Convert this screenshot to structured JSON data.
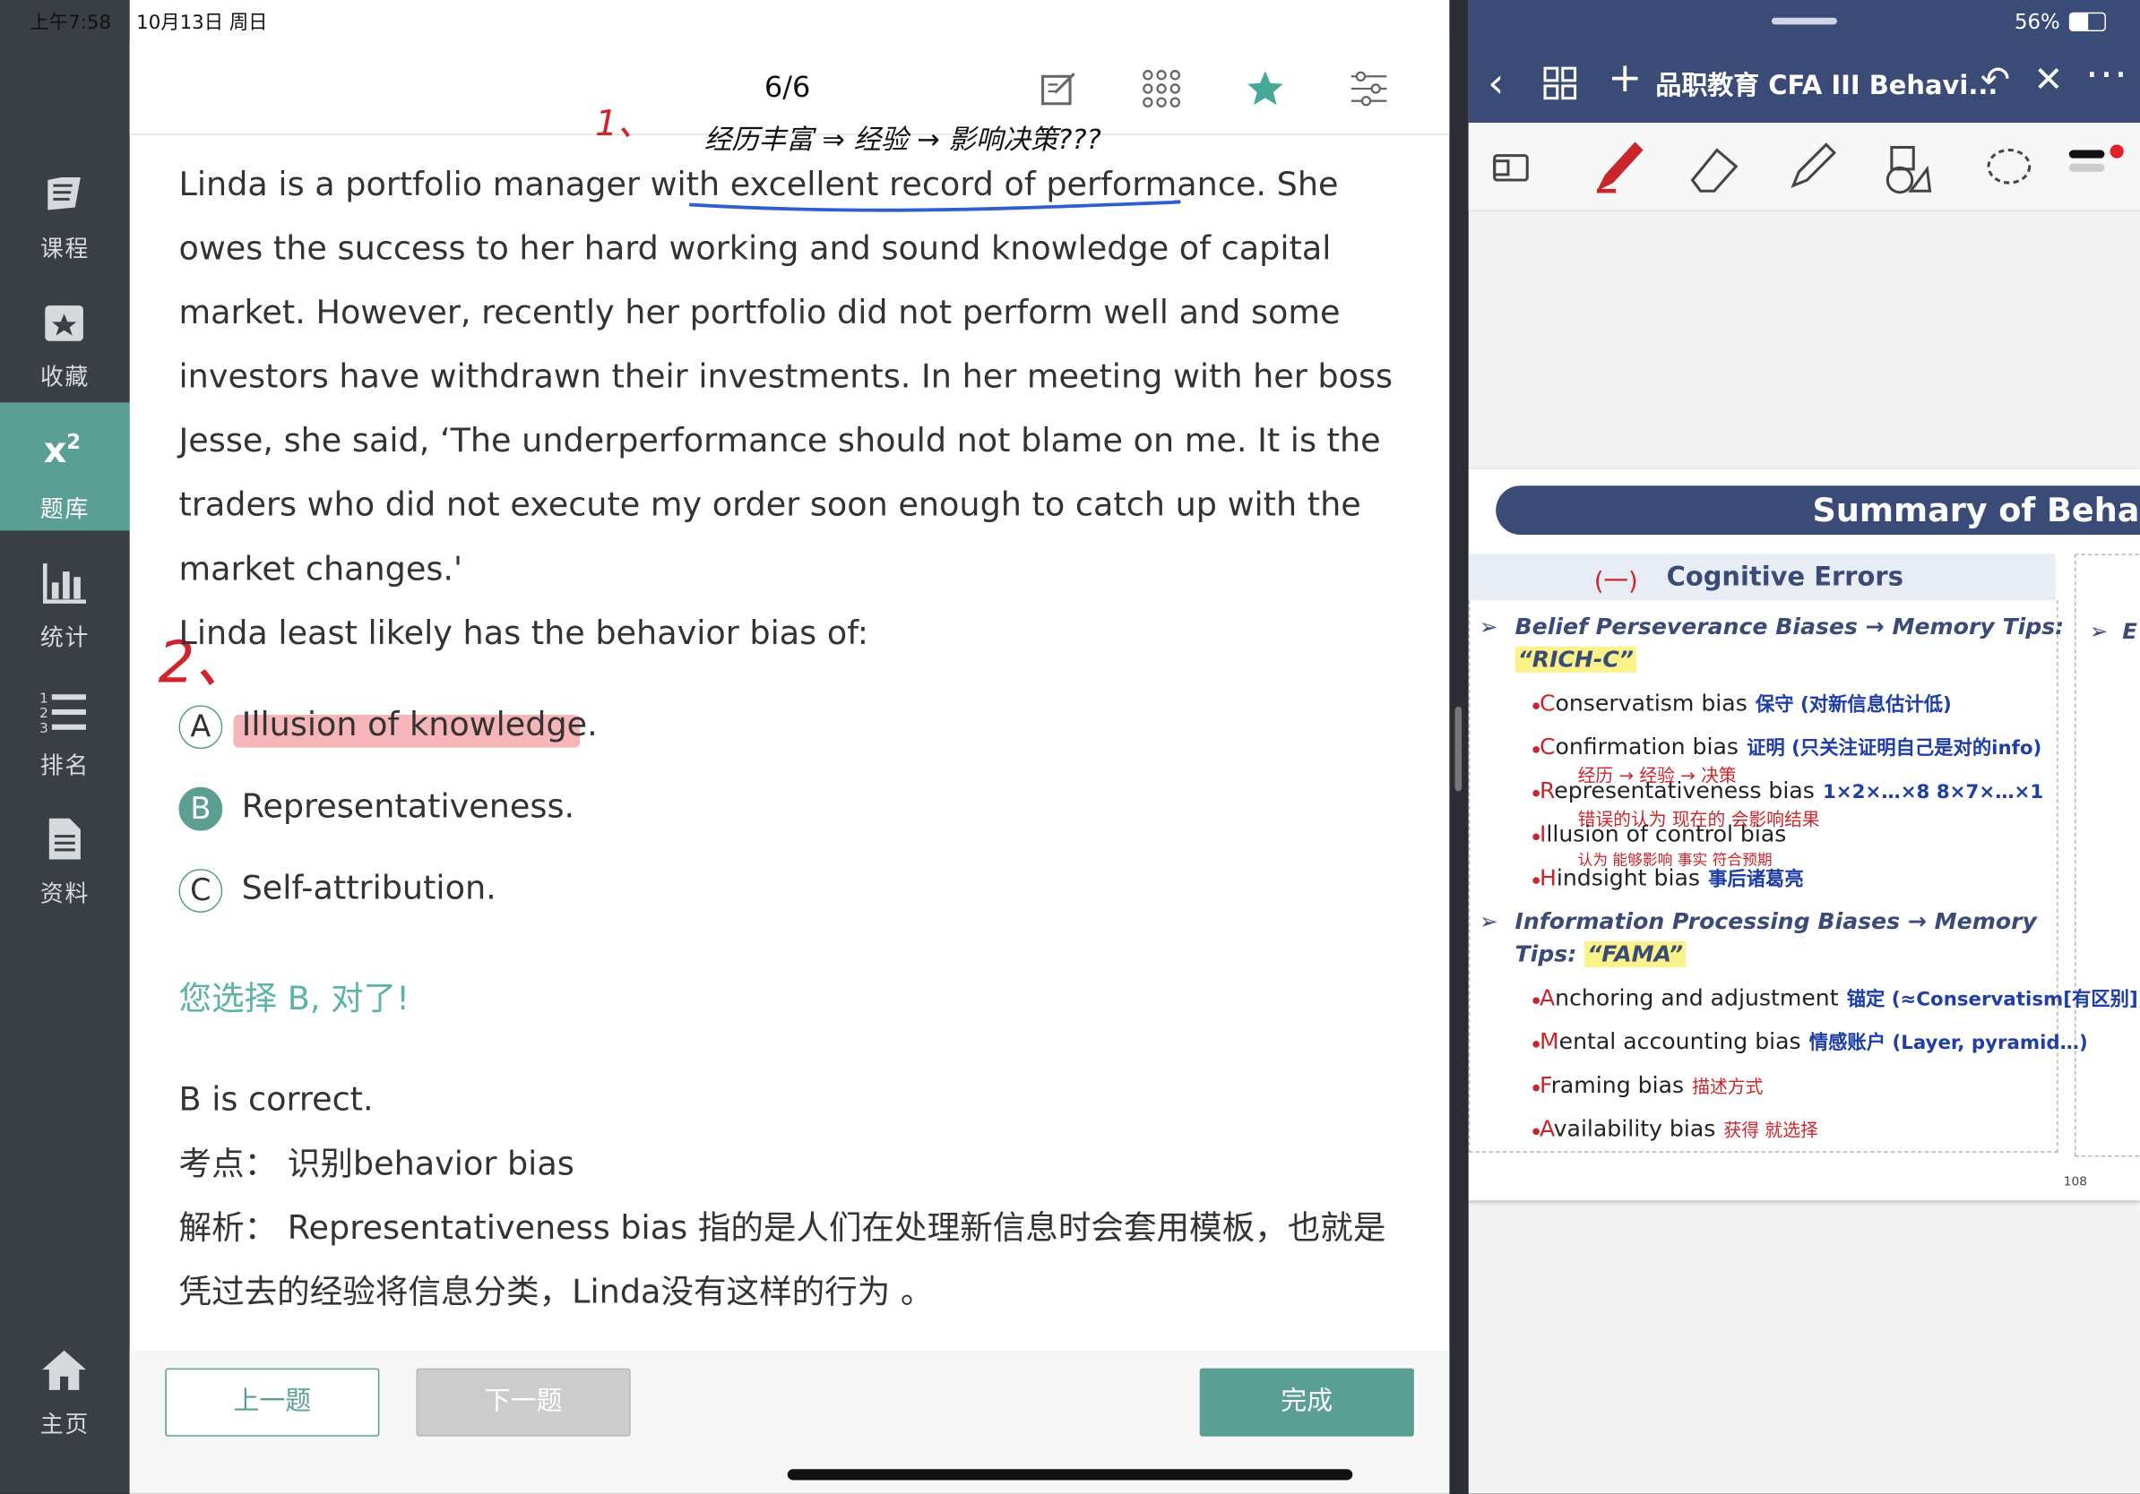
{
  "status": {
    "time": "上午7:58",
    "date": "10月13日 周日",
    "battery": "56%"
  },
  "sidebar": {
    "items": [
      {
        "label": "课程",
        "icon": "book-icon"
      },
      {
        "label": "收藏",
        "icon": "star-box-icon"
      },
      {
        "label": "题库",
        "icon": "x-squared-icon",
        "active": true
      },
      {
        "label": "统计",
        "icon": "bar-chart-icon"
      },
      {
        "label": "排名",
        "icon": "ranking-list-icon"
      },
      {
        "label": "资料",
        "icon": "document-icon"
      },
      {
        "label": "主页",
        "icon": "home-icon"
      }
    ]
  },
  "topbar": {
    "counter": "6/6"
  },
  "question": {
    "text": "Linda is a portfolio manager with excellent record of performance. She owes the success to her hard working and sound knowledge of capital market. However, recently her portfolio did not perform well and some investors have withdrawn their investments. In her meeting with her boss Jesse, she said, ‘The underperformance should not blame on me. It is the traders who did not execute my order soon enough to catch up with the market changes.'",
    "prompt": "Linda least likely has the behavior bias of:"
  },
  "options": [
    {
      "letter": "A",
      "text": "Illusion of knowledge."
    },
    {
      "letter": "B",
      "text": "Representativeness.",
      "selected": true
    },
    {
      "letter": "C",
      "text": "Self-attribution."
    }
  ],
  "result_text": "您选择 B, 对了!",
  "explanation": {
    "answer": "B is correct.",
    "point_label": "考点：",
    "point_value": "识别behavior bias",
    "analysis_label": "解析：",
    "analysis_value": "Representativeness bias 指的是人们在处理新信息时会套用模板，也就是凭过去的经验将信息分类，Linda没有这样的行为 。"
  },
  "annotations": {
    "note1_num": "1、",
    "note1": "经历丰富 ⇒ 经验 → 影响决策???",
    "note2": "2、"
  },
  "buttons": {
    "prev": "上一题",
    "next": "下一题",
    "done": "完成"
  },
  "right_app": {
    "title": "品职教育 CFA III Behavi...",
    "slide": {
      "title": "Summary of Behav",
      "left_header": "Cognitive Errors",
      "left_header_note": "(一)",
      "section1": "Belief Perseverance Biases → Memory Tips:",
      "section1_tip": "“RICH-C”",
      "section2": "Information Processing Biases → Memory",
      "section2_tip_label": "Tips:",
      "section2_tip": "“FAMA”",
      "col2_header": "E",
      "items1": [
        {
          "initial": "C",
          "rest": "onservatism bias",
          "note": "保守 (对新信息估计低)"
        },
        {
          "initial": "C",
          "rest": "onfirmation bias",
          "note": "证明 (只关注证明自己是对的info)"
        },
        {
          "initial": "R",
          "rest": "epresentativeness bias",
          "note": "1×2×…×8  8×7×…×1"
        },
        {
          "initial": "I",
          "rest": "llusion of control bias",
          "note": ""
        },
        {
          "initial": "H",
          "rest": "indsight bias",
          "note": "事后诸葛亮"
        }
      ],
      "items2": [
        {
          "initial": "A",
          "rest": "nchoring and adjustment",
          "note": "锚定 (≈Conservatism[有区别])"
        },
        {
          "initial": "M",
          "rest": "ental accounting bias",
          "note": "情感账户 (Layer, pyramid…)"
        },
        {
          "initial": "F",
          "rest": "raming bias",
          "note": "描述方式"
        },
        {
          "initial": "A",
          "rest": "vailability bias",
          "note": "获得 就选择"
        }
      ],
      "red_notes": {
        "confirmation": "经历 → 经验 → 决策",
        "representativeness": "错误的认为 现在的 会影响结果",
        "illusion": "认为 能够影响 事实 符合预期"
      },
      "page_no": "108"
    }
  }
}
